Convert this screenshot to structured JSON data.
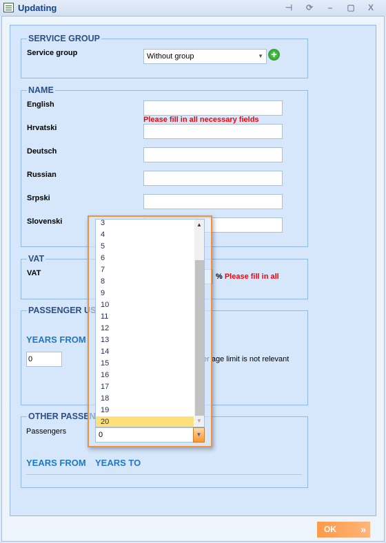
{
  "window": {
    "title": "Updating",
    "icons": [
      "pin-icon",
      "refresh-icon",
      "minimize-icon",
      "maximize-icon",
      "close-icon"
    ]
  },
  "service_group": {
    "legend": "SERVICE GROUP",
    "label": "Service group",
    "value": "Without group"
  },
  "name": {
    "legend": "NAME",
    "error": "Please fill in all necessary fields",
    "fields": [
      {
        "label": "English",
        "value": ""
      },
      {
        "label": "Hrvatski",
        "value": ""
      },
      {
        "label": "Deutsch",
        "value": ""
      },
      {
        "label": "Russian",
        "value": ""
      },
      {
        "label": "Srpski",
        "value": ""
      },
      {
        "label": "Slovenski",
        "value": ""
      }
    ]
  },
  "vat": {
    "legend": "VAT",
    "label": "VAT",
    "unit": "%",
    "error": "Please fill in all"
  },
  "passenger_usage": {
    "legend": "PASSENGER USI",
    "years_from": "YEARS FROM",
    "years_from_value": "0",
    "note": "er age limit is not relevant"
  },
  "other_passengers": {
    "legend": "OTHER PASSENG",
    "label": "Passengers",
    "years_from": "YEARS FROM",
    "years_to": "YEARS TO"
  },
  "dropdown": {
    "options": [
      "3",
      "4",
      "5",
      "6",
      "7",
      "8",
      "9",
      "10",
      "11",
      "12",
      "13",
      "14",
      "15",
      "16",
      "17",
      "18",
      "19",
      "20"
    ],
    "highlighted": "20",
    "value": "0"
  },
  "footer": {
    "ok_label": "OK"
  },
  "colors": {
    "accent": "#f0913c",
    "panel": "#d6e6fb",
    "error": "#ff0000",
    "heading": "#1f78c4"
  }
}
